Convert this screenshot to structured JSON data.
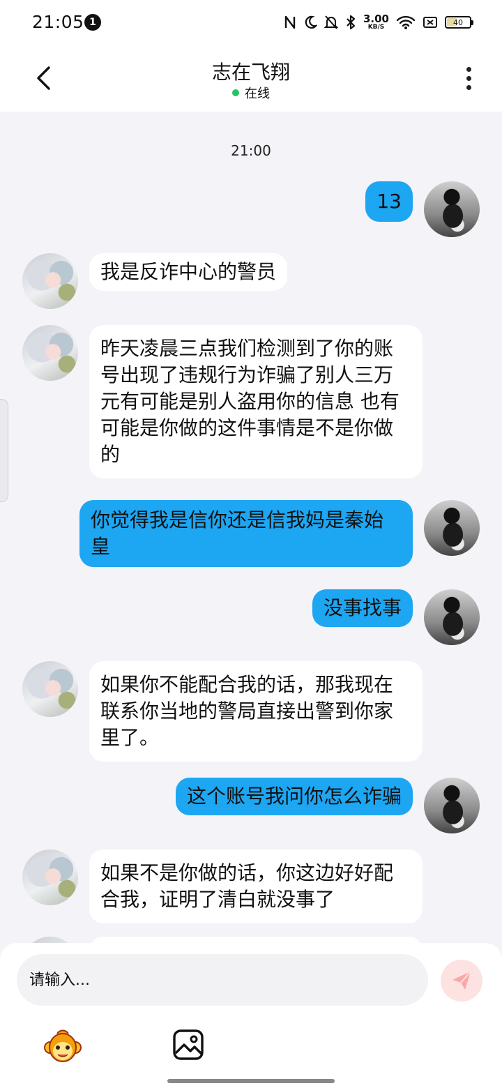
{
  "status_bar": {
    "time": "21:05",
    "notification_count": "1",
    "net_speed_value": "3.00",
    "net_speed_unit": "KB/S",
    "battery_level": "40"
  },
  "header": {
    "title": "志在飞翔",
    "status": "在线"
  },
  "chat": {
    "time_divider": "21:00",
    "messages": [
      {
        "from": "self",
        "text": "13"
      },
      {
        "from": "other",
        "text": "我是反诈中心的警员"
      },
      {
        "from": "other",
        "text": "昨天凌晨三点我们检测到了你的账号出现了违规行为诈骗了别人三万元有可能是别人盗用你的信息  也有可能是你做的这件事情是不是你做的"
      },
      {
        "from": "self",
        "text": "你觉得我是信你还是信我妈是秦始皇"
      },
      {
        "from": "self",
        "text": "没事找事"
      },
      {
        "from": "other",
        "text": "如果你不能配合我的话，那我现在联系你当地的警局直接出警到你家里了。"
      },
      {
        "from": "self",
        "text": "这个账号我问你怎么诈骗"
      },
      {
        "from": "other",
        "text": "如果不是你做的话，你这边好好配合我，证明了清白就没事了"
      }
    ]
  },
  "composer": {
    "placeholder": "请输入..."
  },
  "colors": {
    "outgoing_bubble": "#1da6f2",
    "incoming_bubble": "#ffffff",
    "background": "#f3f3f8",
    "online": "#22c55e",
    "send_button": "#fde2e2"
  },
  "icons": {
    "back": "chevron-left-icon",
    "more": "more-vertical-icon",
    "send": "send-icon",
    "emoji": "emoji-monkey-icon",
    "image": "image-icon"
  }
}
